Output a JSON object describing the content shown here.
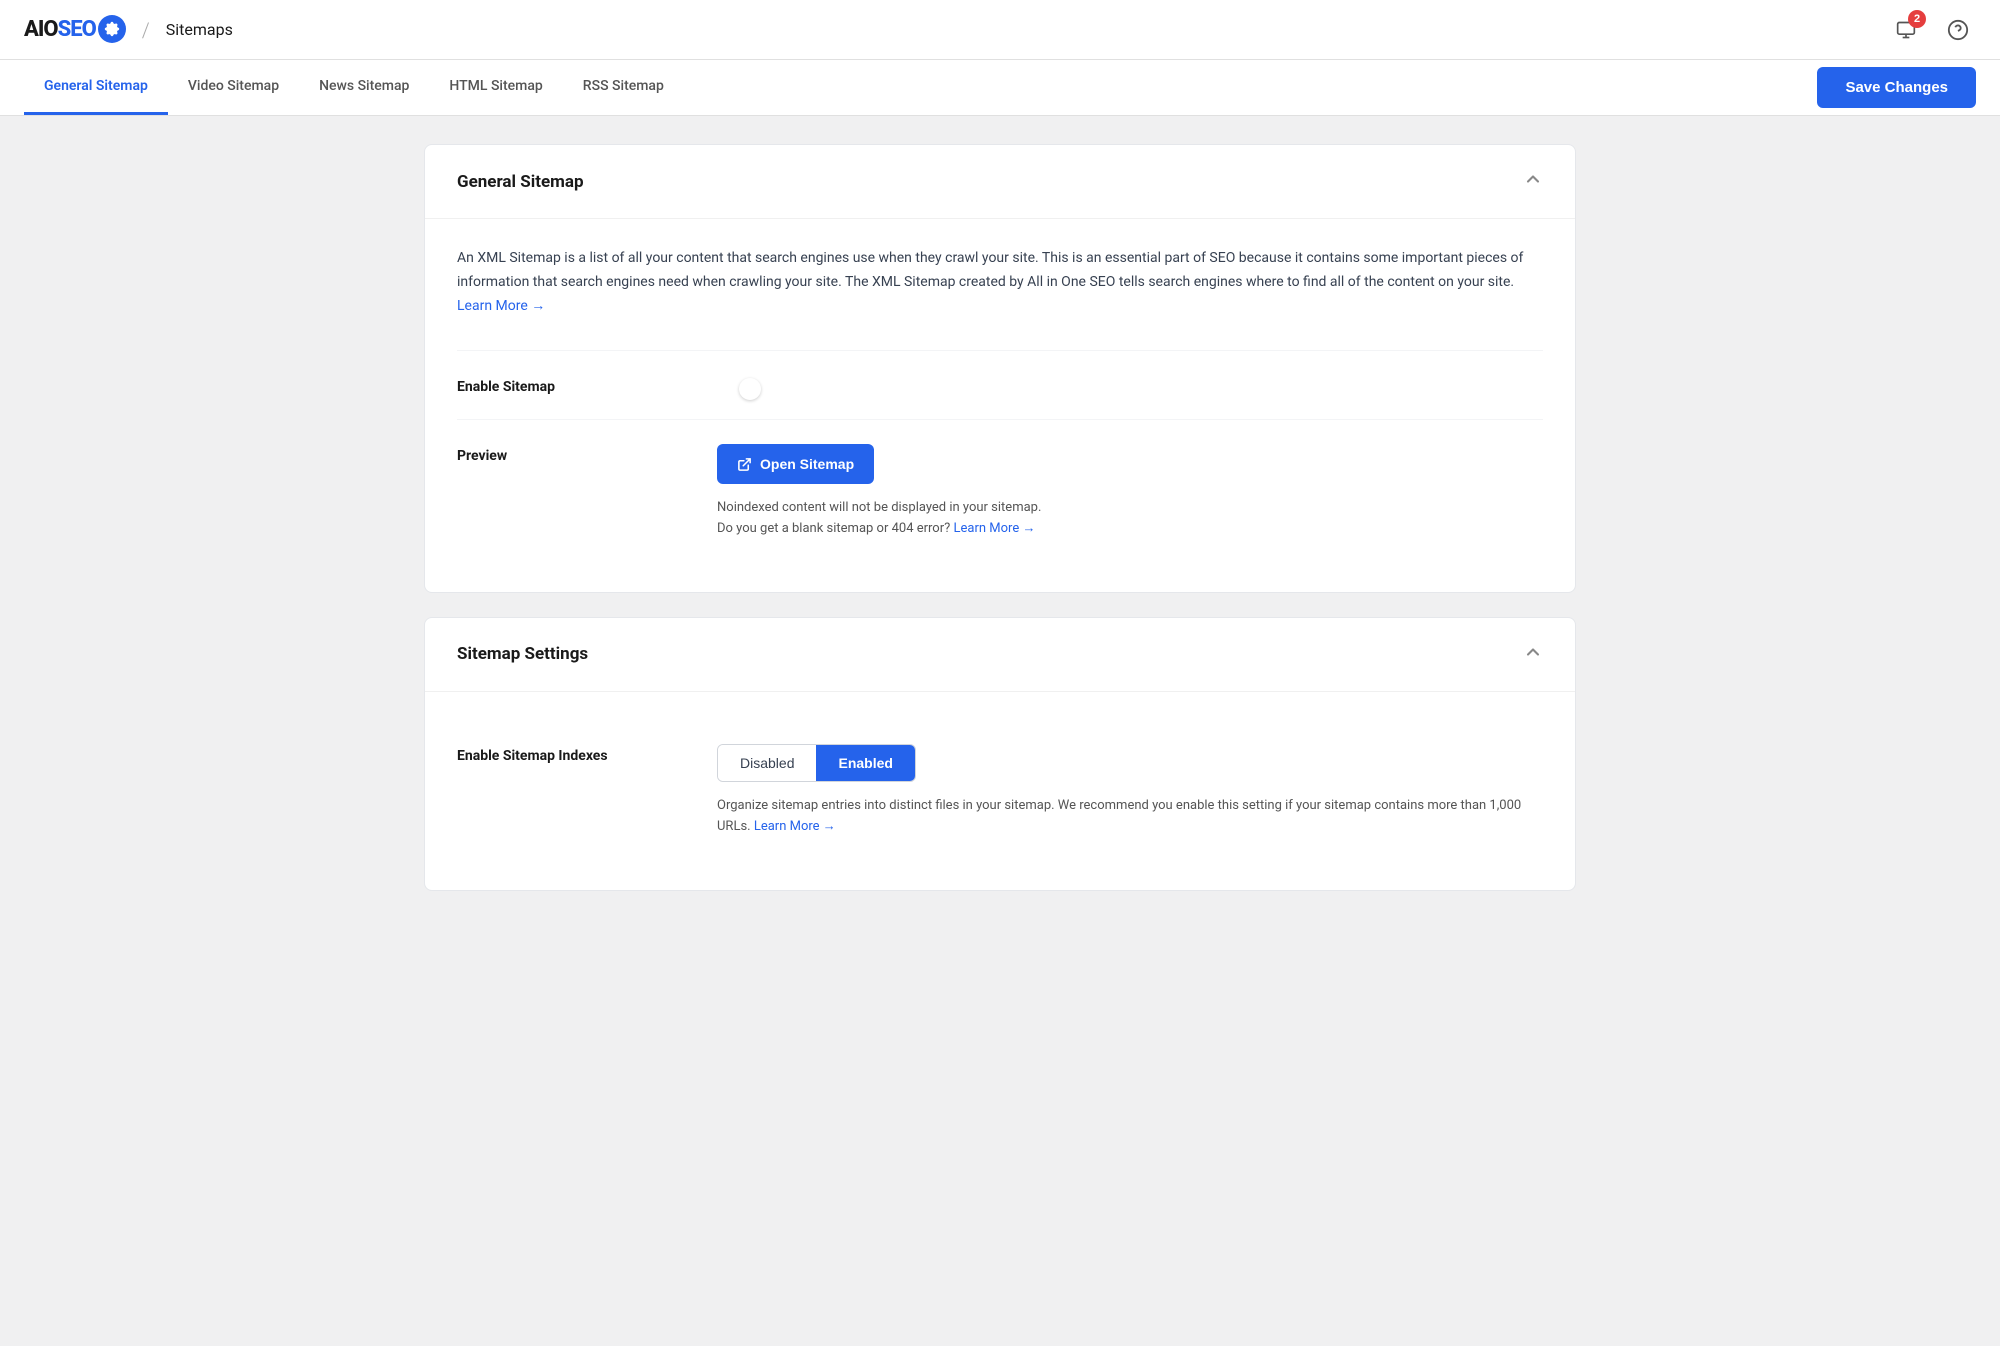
{
  "brand": {
    "name_aio": "AIO",
    "name_seo": "SEO"
  },
  "header": {
    "breadcrumb_separator": "/",
    "page_title": "Sitemaps",
    "notification_count": "2"
  },
  "tabs": {
    "items": [
      {
        "id": "general-sitemap",
        "label": "General Sitemap",
        "active": true
      },
      {
        "id": "video-sitemap",
        "label": "Video Sitemap",
        "active": false
      },
      {
        "id": "news-sitemap",
        "label": "News Sitemap",
        "active": false
      },
      {
        "id": "html-sitemap",
        "label": "HTML Sitemap",
        "active": false
      },
      {
        "id": "rss-sitemap",
        "label": "RSS Sitemap",
        "active": false
      }
    ],
    "save_button": "Save Changes"
  },
  "general_sitemap_card": {
    "title": "General Sitemap",
    "description": "An XML Sitemap is a list of all your content that search engines use when they crawl your site. This is an essential part of SEO because it contains some important pieces of information that search engines need when crawling your site. The XML Sitemap created by All in One SEO tells search engines where to find all of the content on your site.",
    "learn_more_link": "Learn More →",
    "enable_sitemap_label": "Enable Sitemap",
    "toggle_enabled": true,
    "preview_label": "Preview",
    "open_sitemap_button": "Open Sitemap",
    "preview_note_1": "Noindexed content will not be displayed in your sitemap.",
    "preview_note_2": "Do you get a blank sitemap or 404 error?",
    "preview_learn_more": "Learn More →"
  },
  "sitemap_settings_card": {
    "title": "Sitemap Settings",
    "enable_indexes_label": "Enable Sitemap Indexes",
    "indexes_disabled": "Disabled",
    "indexes_enabled": "Enabled",
    "indexes_active": "enabled",
    "indexes_description": "Organize sitemap entries into distinct files in your sitemap. We recommend you enable this setting if your sitemap contains more than 1,000 URLs.",
    "indexes_learn_more": "Learn More →"
  }
}
